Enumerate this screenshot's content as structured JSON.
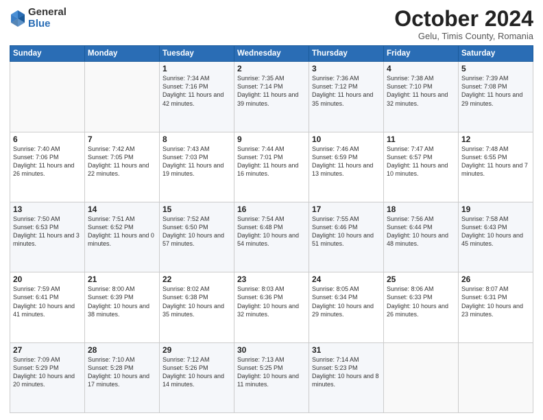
{
  "logo": {
    "general": "General",
    "blue": "Blue"
  },
  "title": "October 2024",
  "subtitle": "Gelu, Timis County, Romania",
  "weekdays": [
    "Sunday",
    "Monday",
    "Tuesday",
    "Wednesday",
    "Thursday",
    "Friday",
    "Saturday"
  ],
  "weeks": [
    [
      {
        "day": "",
        "detail": ""
      },
      {
        "day": "",
        "detail": ""
      },
      {
        "day": "1",
        "detail": "Sunrise: 7:34 AM\nSunset: 7:16 PM\nDaylight: 11 hours and 42 minutes."
      },
      {
        "day": "2",
        "detail": "Sunrise: 7:35 AM\nSunset: 7:14 PM\nDaylight: 11 hours and 39 minutes."
      },
      {
        "day": "3",
        "detail": "Sunrise: 7:36 AM\nSunset: 7:12 PM\nDaylight: 11 hours and 35 minutes."
      },
      {
        "day": "4",
        "detail": "Sunrise: 7:38 AM\nSunset: 7:10 PM\nDaylight: 11 hours and 32 minutes."
      },
      {
        "day": "5",
        "detail": "Sunrise: 7:39 AM\nSunset: 7:08 PM\nDaylight: 11 hours and 29 minutes."
      }
    ],
    [
      {
        "day": "6",
        "detail": "Sunrise: 7:40 AM\nSunset: 7:06 PM\nDaylight: 11 hours and 26 minutes."
      },
      {
        "day": "7",
        "detail": "Sunrise: 7:42 AM\nSunset: 7:05 PM\nDaylight: 11 hours and 22 minutes."
      },
      {
        "day": "8",
        "detail": "Sunrise: 7:43 AM\nSunset: 7:03 PM\nDaylight: 11 hours and 19 minutes."
      },
      {
        "day": "9",
        "detail": "Sunrise: 7:44 AM\nSunset: 7:01 PM\nDaylight: 11 hours and 16 minutes."
      },
      {
        "day": "10",
        "detail": "Sunrise: 7:46 AM\nSunset: 6:59 PM\nDaylight: 11 hours and 13 minutes."
      },
      {
        "day": "11",
        "detail": "Sunrise: 7:47 AM\nSunset: 6:57 PM\nDaylight: 11 hours and 10 minutes."
      },
      {
        "day": "12",
        "detail": "Sunrise: 7:48 AM\nSunset: 6:55 PM\nDaylight: 11 hours and 7 minutes."
      }
    ],
    [
      {
        "day": "13",
        "detail": "Sunrise: 7:50 AM\nSunset: 6:53 PM\nDaylight: 11 hours and 3 minutes."
      },
      {
        "day": "14",
        "detail": "Sunrise: 7:51 AM\nSunset: 6:52 PM\nDaylight: 11 hours and 0 minutes."
      },
      {
        "day": "15",
        "detail": "Sunrise: 7:52 AM\nSunset: 6:50 PM\nDaylight: 10 hours and 57 minutes."
      },
      {
        "day": "16",
        "detail": "Sunrise: 7:54 AM\nSunset: 6:48 PM\nDaylight: 10 hours and 54 minutes."
      },
      {
        "day": "17",
        "detail": "Sunrise: 7:55 AM\nSunset: 6:46 PM\nDaylight: 10 hours and 51 minutes."
      },
      {
        "day": "18",
        "detail": "Sunrise: 7:56 AM\nSunset: 6:44 PM\nDaylight: 10 hours and 48 minutes."
      },
      {
        "day": "19",
        "detail": "Sunrise: 7:58 AM\nSunset: 6:43 PM\nDaylight: 10 hours and 45 minutes."
      }
    ],
    [
      {
        "day": "20",
        "detail": "Sunrise: 7:59 AM\nSunset: 6:41 PM\nDaylight: 10 hours and 41 minutes."
      },
      {
        "day": "21",
        "detail": "Sunrise: 8:00 AM\nSunset: 6:39 PM\nDaylight: 10 hours and 38 minutes."
      },
      {
        "day": "22",
        "detail": "Sunrise: 8:02 AM\nSunset: 6:38 PM\nDaylight: 10 hours and 35 minutes."
      },
      {
        "day": "23",
        "detail": "Sunrise: 8:03 AM\nSunset: 6:36 PM\nDaylight: 10 hours and 32 minutes."
      },
      {
        "day": "24",
        "detail": "Sunrise: 8:05 AM\nSunset: 6:34 PM\nDaylight: 10 hours and 29 minutes."
      },
      {
        "day": "25",
        "detail": "Sunrise: 8:06 AM\nSunset: 6:33 PM\nDaylight: 10 hours and 26 minutes."
      },
      {
        "day": "26",
        "detail": "Sunrise: 8:07 AM\nSunset: 6:31 PM\nDaylight: 10 hours and 23 minutes."
      }
    ],
    [
      {
        "day": "27",
        "detail": "Sunrise: 7:09 AM\nSunset: 5:29 PM\nDaylight: 10 hours and 20 minutes."
      },
      {
        "day": "28",
        "detail": "Sunrise: 7:10 AM\nSunset: 5:28 PM\nDaylight: 10 hours and 17 minutes."
      },
      {
        "day": "29",
        "detail": "Sunrise: 7:12 AM\nSunset: 5:26 PM\nDaylight: 10 hours and 14 minutes."
      },
      {
        "day": "30",
        "detail": "Sunrise: 7:13 AM\nSunset: 5:25 PM\nDaylight: 10 hours and 11 minutes."
      },
      {
        "day": "31",
        "detail": "Sunrise: 7:14 AM\nSunset: 5:23 PM\nDaylight: 10 hours and 8 minutes."
      },
      {
        "day": "",
        "detail": ""
      },
      {
        "day": "",
        "detail": ""
      }
    ]
  ]
}
